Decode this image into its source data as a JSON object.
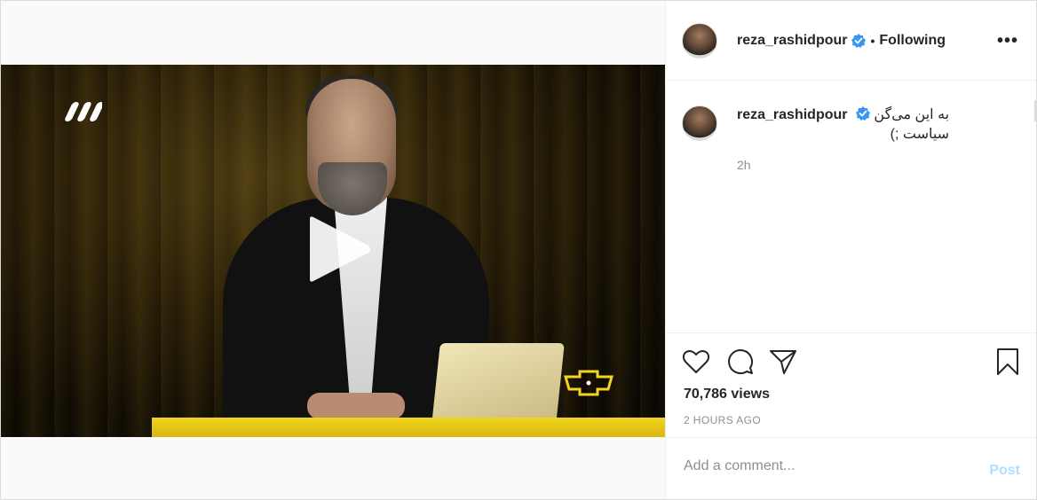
{
  "post": {
    "username": "reza_rashidpour",
    "verified": true,
    "separator": "•",
    "follow_status": "Following",
    "more_label": "•••"
  },
  "caption": {
    "username": "reza_rashidpour",
    "line1": "به این می‌گن",
    "line2": "سیاست ;)",
    "time": "2h"
  },
  "stats": {
    "views": "70,786 views",
    "posted": "2 HOURS AGO"
  },
  "comment": {
    "placeholder": "Add a comment...",
    "post_label": "Post"
  },
  "colors": {
    "verified_blue": "#3897f0",
    "post_disabled": "#b2dffc",
    "muted": "#8e8e8e",
    "desk_yellow": "#f1d51f"
  },
  "icons": [
    "heart-icon",
    "comment-icon",
    "share-icon",
    "bookmark-icon",
    "play-icon",
    "verified-badge-icon",
    "more-icon"
  ]
}
